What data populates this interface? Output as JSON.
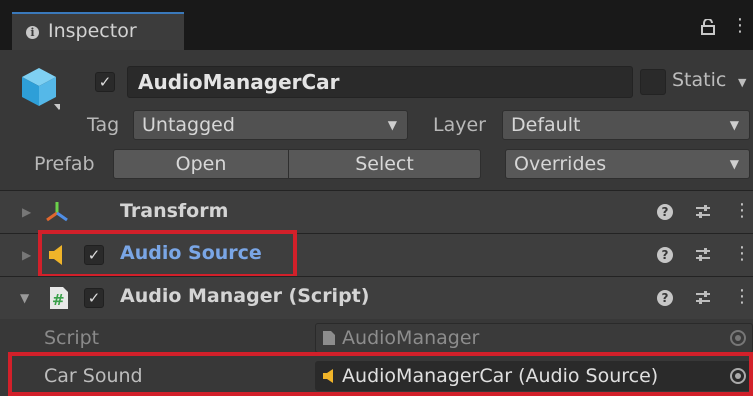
{
  "tab": {
    "title": "Inspector"
  },
  "gameobject": {
    "name": "AudioManagerCar",
    "static_label": "Static",
    "tag_label": "Tag",
    "tag_value": "Untagged",
    "layer_label": "Layer",
    "layer_value": "Default",
    "prefab_label": "Prefab",
    "open_label": "Open",
    "select_label": "Select",
    "overrides_label": "Overrides"
  },
  "components": [
    {
      "title": "Transform"
    },
    {
      "title": "Audio Source"
    },
    {
      "title": "Audio Manager (Script)"
    }
  ],
  "properties": {
    "script_label": "Script",
    "script_value": "AudioManager",
    "car_sound_label": "Car Sound",
    "car_sound_value": "AudioManagerCar (Audio Source)"
  },
  "colors": {
    "highlight": "#d2202a",
    "accent_blue": "#7aa6e6",
    "tab_accent": "#3a79bb"
  }
}
